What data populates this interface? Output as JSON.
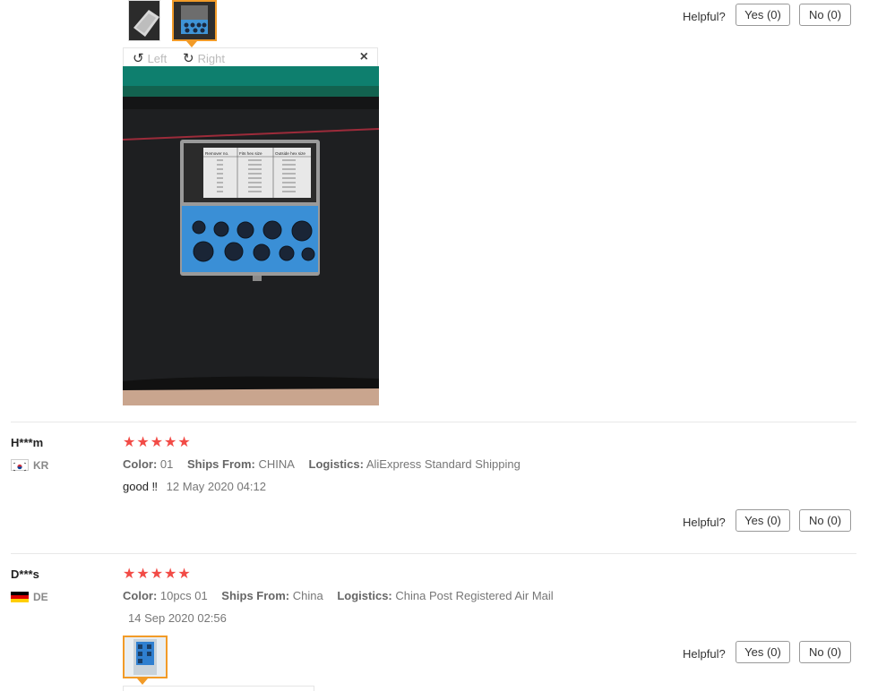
{
  "review1": {
    "helpful_label": "Helpful?",
    "yes_label": "Yes (0)",
    "no_label": "No (0)",
    "viewer": {
      "rotate_left": "Left",
      "rotate_right": "Right",
      "close_symbol": "×",
      "table_headers": [
        "Remover no.",
        "Fits hex size",
        "Outside hex size"
      ]
    }
  },
  "review2": {
    "name": "H***m",
    "country": "KR",
    "rating": 5,
    "stars": "★★★★★",
    "color_label": "Color:",
    "color_value": "01",
    "ships_label": "Ships From:",
    "ships_value": "CHINA",
    "logistics_label": "Logistics:",
    "logistics_value": "AliExpress Standard Shipping",
    "text": "good ‼",
    "date": "12 May 2020 04:12",
    "helpful_label": "Helpful?",
    "yes_label": "Yes (0)",
    "no_label": "No (0)"
  },
  "review3": {
    "name": "D***s",
    "country": "DE",
    "rating": 5,
    "stars": "★★★★★",
    "color_label": "Color:",
    "color_value": "10pcs 01",
    "ships_label": "Ships From:",
    "ships_value": "China",
    "logistics_label": "Logistics:",
    "logistics_value": "China Post Registered Air Mail",
    "date": "14 Sep 2020 02:56",
    "helpful_label": "Helpful?",
    "yes_label": "Yes (0)",
    "no_label": "No (0)"
  },
  "colors": {
    "star": "#f24b46",
    "active_thumb": "#f29b28",
    "separator": "#e8e8e8"
  }
}
